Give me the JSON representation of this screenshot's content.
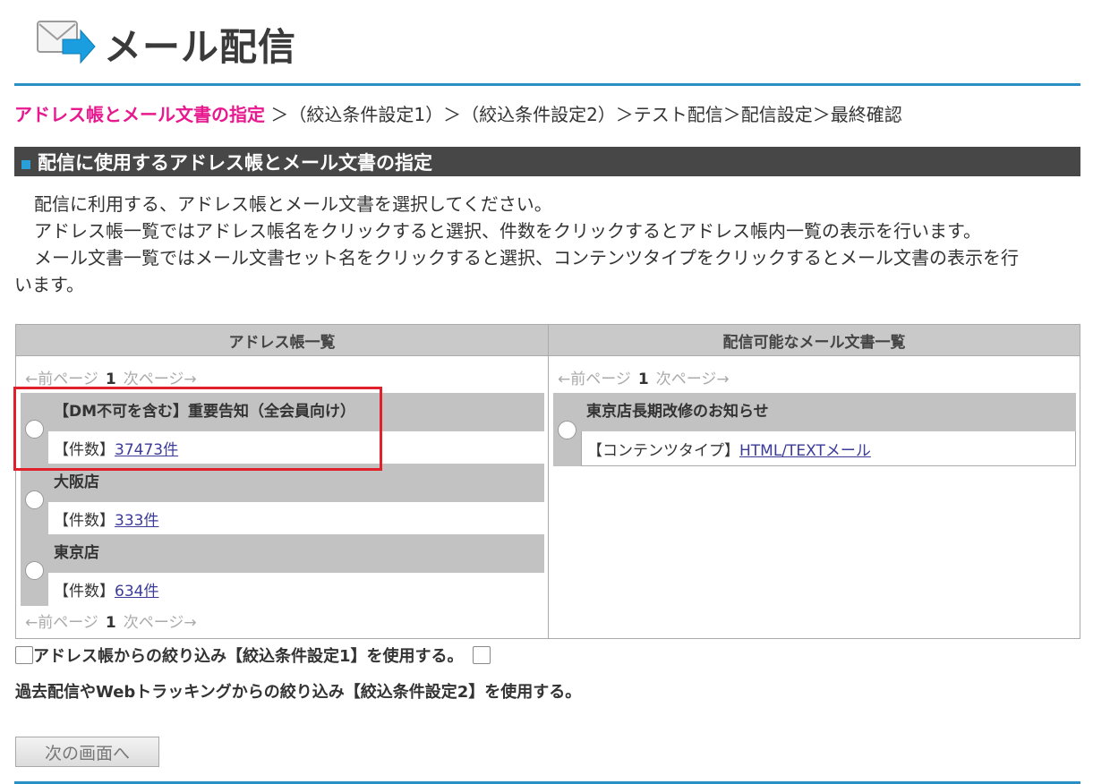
{
  "page": {
    "title": "メール配信",
    "steps": {
      "current": "アドレス帳とメール文書の指定",
      "rest": " ＞（絞込条件設定1）＞（絞込条件設定2）＞テスト配信＞配信設定＞最終確認"
    },
    "section_title": "配信に使用するアドレス帳とメール文書の指定",
    "description": [
      "配信に利用する、アドレス帳とメール文書を選択してください。",
      "アドレス帳一覧ではアドレス帳名をクリックすると選択、件数をクリックするとアドレス帳内一覧の表示を行います。",
      "メール文書一覧ではメール文書セット名をクリックすると選択、コンテンツタイプをクリックするとメール文書の表示を行",
      "います。"
    ]
  },
  "address_list": {
    "header": "アドレス帳一覧",
    "pager": {
      "prev": "←前ページ",
      "page": "1",
      "next": "次ページ→"
    },
    "count_label": "【件数】",
    "items": [
      {
        "name": "【DM不可を含む】重要告知（全会員向け）",
        "count": "37473件"
      },
      {
        "name": "大阪店",
        "count": "333件"
      },
      {
        "name": "東京店",
        "count": "634件"
      }
    ]
  },
  "mail_list": {
    "header": "配信可能なメール文書一覧",
    "pager": {
      "prev": "←前ページ",
      "page": "1",
      "next": "次ページ→"
    },
    "content_type_label": "【コンテンツタイプ】",
    "items": [
      {
        "name": "東京店長期改修のお知らせ",
        "content_type": "HTML/TEXTメール"
      }
    ]
  },
  "options": {
    "filter1": "アドレス帳からの絞り込み【絞込条件設定1】を使用する。",
    "filter2": "過去配信やWebトラッキングからの絞り込み【絞込条件設定2】を使用する。"
  },
  "next_button": "次の画面へ"
}
